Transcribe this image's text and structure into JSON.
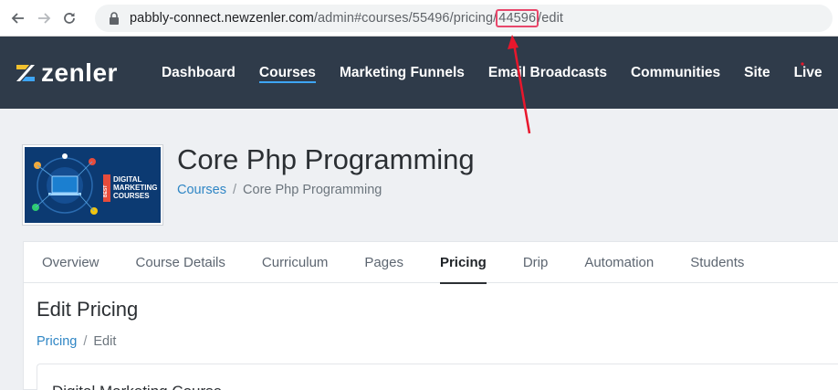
{
  "browser": {
    "url_host": "pabbly-connect.newzenler.com",
    "url_path_before": "/admin#courses/55496/pricing/",
    "url_highlight": "44596",
    "url_path_after": "/edit"
  },
  "header": {
    "logo_text": "zenler",
    "nav": [
      {
        "label": "Dashboard"
      },
      {
        "label": "Courses"
      },
      {
        "label": "Marketing Funnels"
      },
      {
        "label": "Email Broadcasts"
      },
      {
        "label": "Communities"
      },
      {
        "label": "Site"
      },
      {
        "label": "Live"
      }
    ],
    "active_nav": "Courses"
  },
  "course": {
    "thumbnail": {
      "badge": "BEST",
      "line1": "DIGITAL",
      "line2": "MARKETING",
      "line3": "COURSES"
    },
    "title": "Core Php Programming",
    "breadcrumb": {
      "link": "Courses",
      "separator": "/",
      "current": "Core Php Programming"
    }
  },
  "tabs": [
    {
      "label": "Overview"
    },
    {
      "label": "Course Details"
    },
    {
      "label": "Curriculum"
    },
    {
      "label": "Pages"
    },
    {
      "label": "Pricing"
    },
    {
      "label": "Drip"
    },
    {
      "label": "Automation"
    },
    {
      "label": "Students"
    }
  ],
  "active_tab": "Pricing",
  "section": {
    "title": "Edit Pricing",
    "breadcrumb": {
      "link": "Pricing",
      "separator": "/",
      "current": "Edit"
    },
    "panel_title": "Digital Marketing Course"
  },
  "colors": {
    "header_bg": "#2f3b4a",
    "accent_blue": "#3ea5f4",
    "link_blue": "#2f86c5",
    "annotation_red": "#e8172c",
    "highlight_pink": "#e8476b"
  }
}
